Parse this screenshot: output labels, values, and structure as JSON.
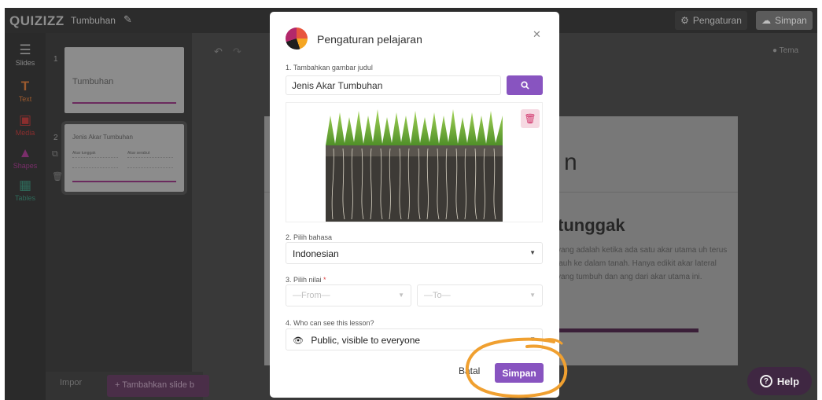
{
  "header": {
    "logo": "QUIZIZZ",
    "title": "Tumbuhan",
    "settings_label": "Pengaturan",
    "save_label": "Simpan"
  },
  "toolbar": {
    "items": [
      {
        "label": "Slides"
      },
      {
        "label": "Text"
      },
      {
        "label": "Media"
      },
      {
        "label": "Shapes"
      },
      {
        "label": "Tables"
      }
    ]
  },
  "slides": [
    {
      "number": "1",
      "title": "Tumbuhan"
    },
    {
      "number": "2",
      "title": "Jenis Akar Tumbuhan",
      "col1": "Akar tunggak",
      "col2": "Akar serabut"
    }
  ],
  "canvas": {
    "theme_label": "Tema",
    "preview_bigletter": "n",
    "preview_heading": "tunggak",
    "preview_body": "yang adalah ketika ada satu akar utama uh terus jauh ke dalam tanah. Hanya edikit akar lateral yang tumbuh dan ang dari akar utama ini."
  },
  "bottom": {
    "import_label": "Impor",
    "add_slide_label": "+ Tambahkan slide b"
  },
  "help": {
    "label": "Help"
  },
  "modal": {
    "title": "Pengaturan pelajaran",
    "image_label": "1. Tambahkan gambar judul",
    "image_search_value": "Jenis Akar Tumbuhan",
    "language_label": "2. Pilih bahasa",
    "language_value": "Indonesian",
    "grade_label": "3. Pilih nilai",
    "grade_required": "*",
    "grade_from_placeholder": "—From—",
    "grade_to_placeholder": "—To—",
    "visibility_label": "4. Who can see this lesson?",
    "visibility_value": "Public, visible to everyone",
    "cancel_label": "Batal",
    "save_label": "Simpan"
  },
  "colors": {
    "accent": "#8854c0",
    "annotation": "#f0a030"
  },
  "icons": {
    "logo": "quizizz-logo-icon",
    "close": "close-icon",
    "search": "search-icon",
    "delete": "trash-icon",
    "visibility": "eye-icon",
    "help": "question-circle-icon"
  }
}
